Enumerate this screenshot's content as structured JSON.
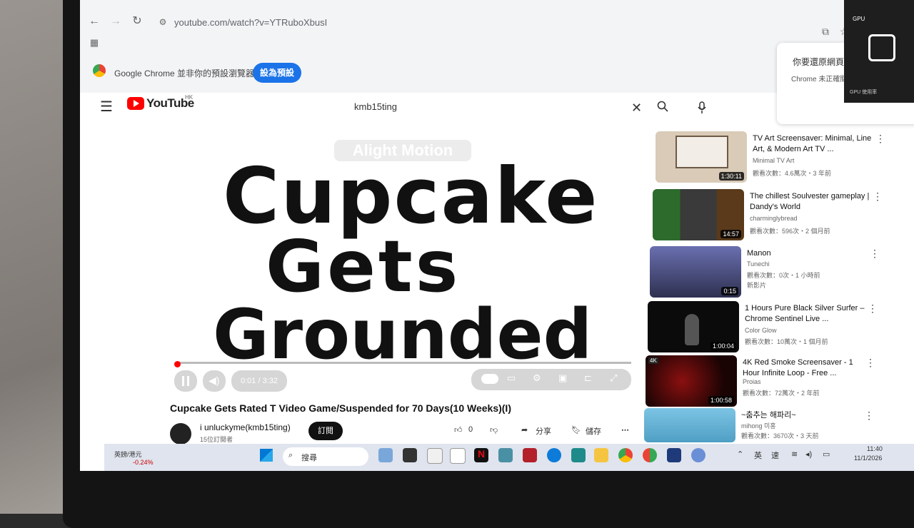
{
  "browser": {
    "url": "youtube.com/watch?v=YTRuboXbusI",
    "default_banner_text": "Google Chrome 並非你的預設瀏覽器",
    "set_default_label": "設為預設",
    "restore_title": "你要還原網頁",
    "restore_body": "Chrome 未正確關"
  },
  "youtube": {
    "logo_text": "YouTube",
    "region": "HK",
    "search_query": "kmb15ting",
    "video": {
      "watermark": "Alight Motion",
      "art_text": [
        "Cupcake",
        "Gets",
        "Grounded"
      ],
      "time": "0:01 / 3:32",
      "progress_fraction": 0.005,
      "title": "Cupcake Gets Rated T Video Game/Suspended for 70 Days(10 Weeks)(I)",
      "channel": "i unluckyme(kmb15ting)",
      "subscribers": "15位訂閱者",
      "subscribe_label": "訂閱",
      "likes": "0",
      "share_label": "分享",
      "save_label": "儲存"
    },
    "recommendations": [
      {
        "title": "TV Art Screensaver: Minimal, Line Art, & Modern Art TV ...",
        "channel": "Minimal TV Art",
        "meta": "觀看次數：4.6萬次・3 年前",
        "duration": "1:30:11",
        "thumb_color": "#c9b9a6"
      },
      {
        "title": "The chillest Soulvester gameplay | Dandy's World",
        "channel": "charminglybread",
        "meta": "觀看次數：596次・2 個月前",
        "duration": "14:57",
        "thumb_color": "#3a3a3a"
      },
      {
        "title": "Manon",
        "channel": "Tunechi",
        "meta": "觀看次數：0次・1 小時前",
        "meta2": "新影片",
        "duration": "0:15",
        "thumb_color": "#4b4f7a"
      },
      {
        "title": "1 Hours Pure Black Silver Surfer – Chrome Sentinel Live ...",
        "channel": "Color Glow",
        "meta": "觀看次數：10萬次・1 個月前",
        "duration": "1:00:04",
        "thumb_color": "#0b0b0b"
      },
      {
        "title": "4K Red Smoke Screensaver - 1 Hour Infinite Loop - Free ...",
        "channel": "Proias",
        "meta": "觀看次數：72萬次・2 年前",
        "duration": "1:00:58",
        "thumb_color": "#2a0606"
      },
      {
        "title": "~춤추는 해파리~",
        "channel": "mihong 미홍",
        "meta": "觀看次數：3670次・3 天前",
        "duration": "",
        "thumb_color": "#6fb7d9"
      }
    ]
  },
  "taskbar": {
    "stock_name": "英鎊/港元",
    "stock_change": "-0.24%",
    "search_label": "搜尋",
    "lang1": "英",
    "lang2": "速",
    "time": "11:40",
    "date": "11/1/2026"
  },
  "capcut": {
    "lines": [
      "GPU",
      "GPU 使用率"
    ]
  }
}
